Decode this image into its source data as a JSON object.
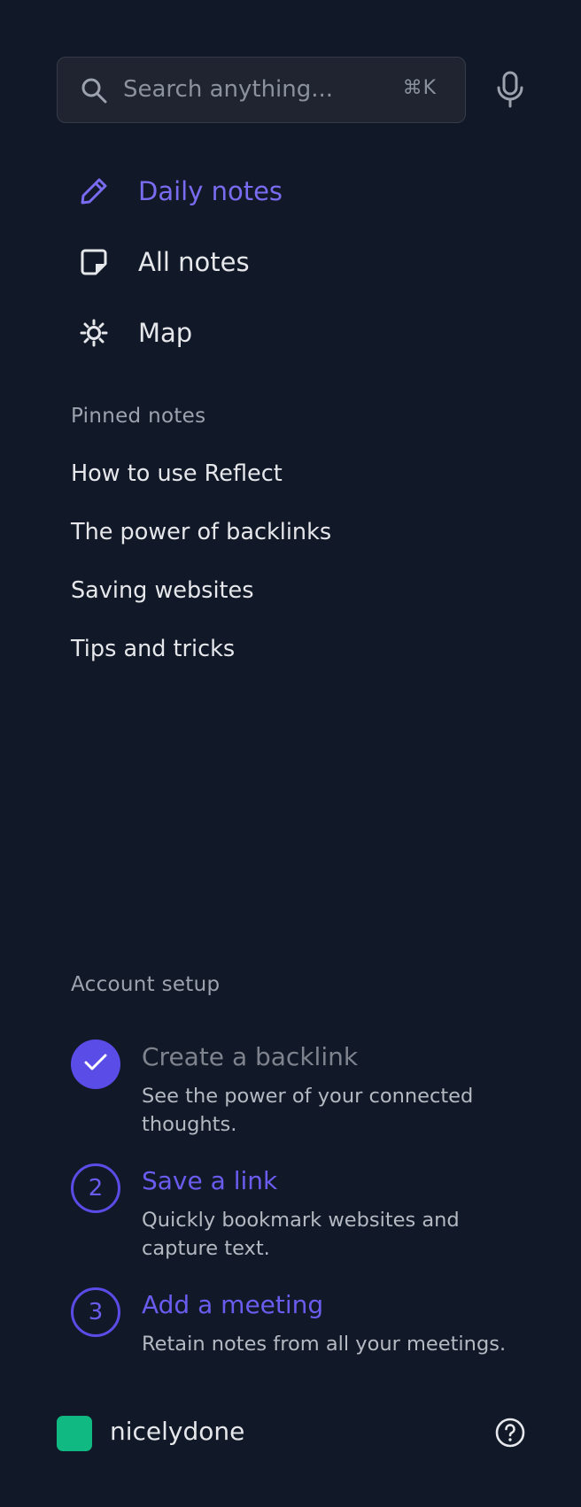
{
  "search": {
    "placeholder": "Search anything...",
    "shortcut": "⌘K",
    "icon": "search-icon"
  },
  "mic": {
    "icon": "microphone-icon"
  },
  "nav": {
    "items": [
      {
        "label": "Daily notes",
        "icon": "pencil-icon",
        "active": true
      },
      {
        "label": "All notes",
        "icon": "note-icon",
        "active": false
      },
      {
        "label": "Map",
        "icon": "sun-map-icon",
        "active": false
      }
    ]
  },
  "pinned": {
    "title": "Pinned notes",
    "items": [
      "How to use Reflect",
      "The power of backlinks",
      "Saving websites",
      "Tips and tricks"
    ]
  },
  "setup": {
    "title": "Account setup",
    "steps": [
      {
        "marker": "",
        "status": "done",
        "title": "Create a backlink",
        "description": "See the power of your connected thoughts."
      },
      {
        "marker": "2",
        "status": "todo",
        "title": "Save a link",
        "description": "Quickly bookmark websites and capture text."
      },
      {
        "marker": "3",
        "status": "todo",
        "title": "Add a meeting",
        "description": "Retain notes from all your meetings."
      }
    ]
  },
  "footer": {
    "username": "nicelydone",
    "avatar_color": "#10b981",
    "help_icon": "help-circle-icon"
  },
  "colors": {
    "background": "#111827",
    "accent": "#6b5cf0",
    "text": "#e5e7eb",
    "muted": "#9ca3af"
  }
}
